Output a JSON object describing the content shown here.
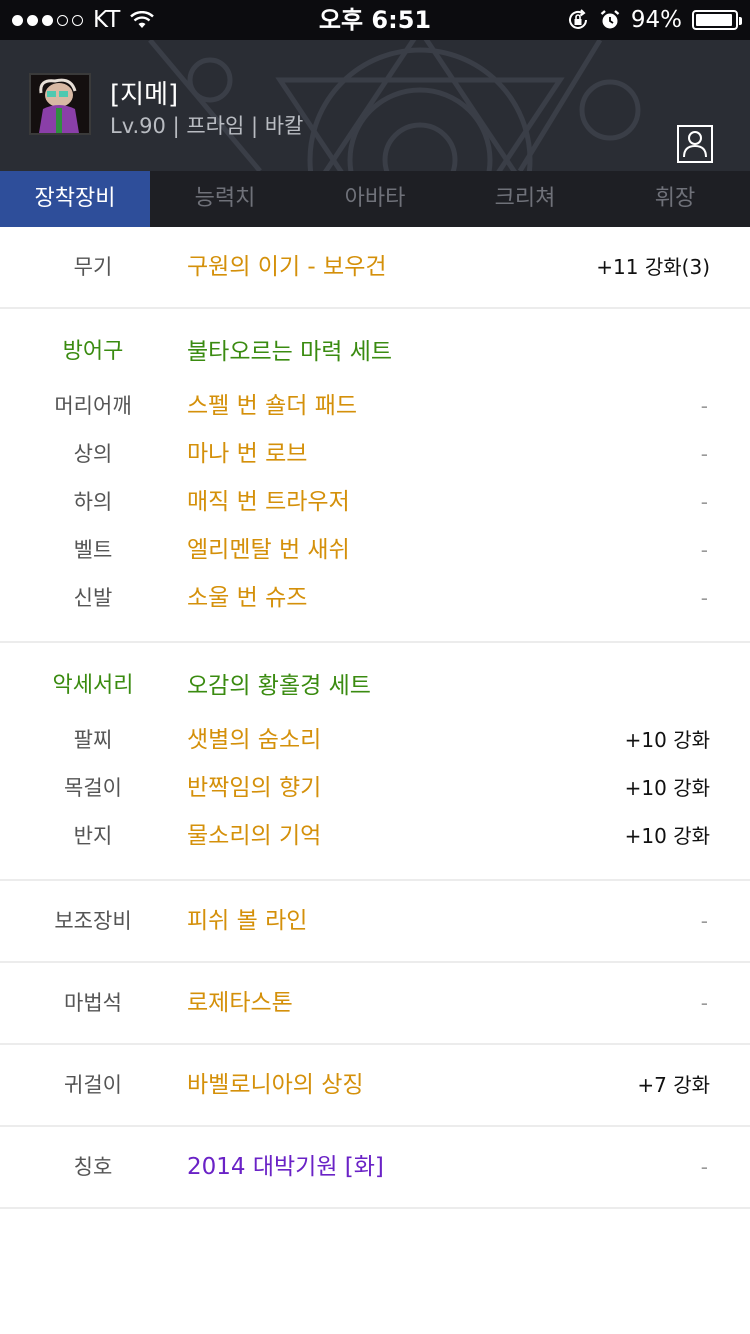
{
  "status_bar": {
    "carrier": "KT",
    "time": "오후 6:51",
    "battery_percent": "94%",
    "battery_level": 0.94
  },
  "profile": {
    "name": "[지메]",
    "info": "Lv.90 | 프라임 | 바칼"
  },
  "tabs": [
    {
      "label": "장착장비",
      "active": true
    },
    {
      "label": "능력치",
      "active": false
    },
    {
      "label": "아바타",
      "active": false
    },
    {
      "label": "크리쳐",
      "active": false
    },
    {
      "label": "휘장",
      "active": false
    }
  ],
  "equipment": {
    "weapon": {
      "category": "무기",
      "item": "구원의 이기 - 보우건",
      "enhance": "+11 강화(3)"
    },
    "armor": {
      "set_category": "방어구",
      "set_name": "불타오르는 마력 세트",
      "items": [
        {
          "category": "머리어깨",
          "item": "스펠 번 숄더 패드",
          "enhance": "-"
        },
        {
          "category": "상의",
          "item": "마나 번 로브",
          "enhance": "-"
        },
        {
          "category": "하의",
          "item": "매직 번 트라우저",
          "enhance": "-"
        },
        {
          "category": "벨트",
          "item": "엘리멘탈 번 새쉬",
          "enhance": "-"
        },
        {
          "category": "신발",
          "item": "소울 번 슈즈",
          "enhance": "-"
        }
      ]
    },
    "accessory": {
      "set_category": "악세서리",
      "set_name": "오감의 황홀경 세트",
      "items": [
        {
          "category": "팔찌",
          "item": "샛별의 숨소리",
          "enhance": "+10 강화"
        },
        {
          "category": "목걸이",
          "item": "반짝임의 향기",
          "enhance": "+10 강화"
        },
        {
          "category": "반지",
          "item": "물소리의 기억",
          "enhance": "+10 강화"
        }
      ]
    },
    "sub": {
      "category": "보조장비",
      "item": "피쉬 볼 라인",
      "enhance": "-"
    },
    "magic_stone": {
      "category": "마법석",
      "item": "로제타스톤",
      "enhance": "-"
    },
    "earring": {
      "category": "귀걸이",
      "item": "바벨로니아의 상징",
      "enhance": "+7 강화"
    },
    "title": {
      "category": "칭호",
      "item": "2014 대박기원 [화]",
      "enhance": "-"
    }
  },
  "colors": {
    "item_orange": "#d4900a",
    "set_green": "#3a8b10",
    "title_purple": "#6a22c6",
    "tab_active": "#2e4e9a"
  }
}
